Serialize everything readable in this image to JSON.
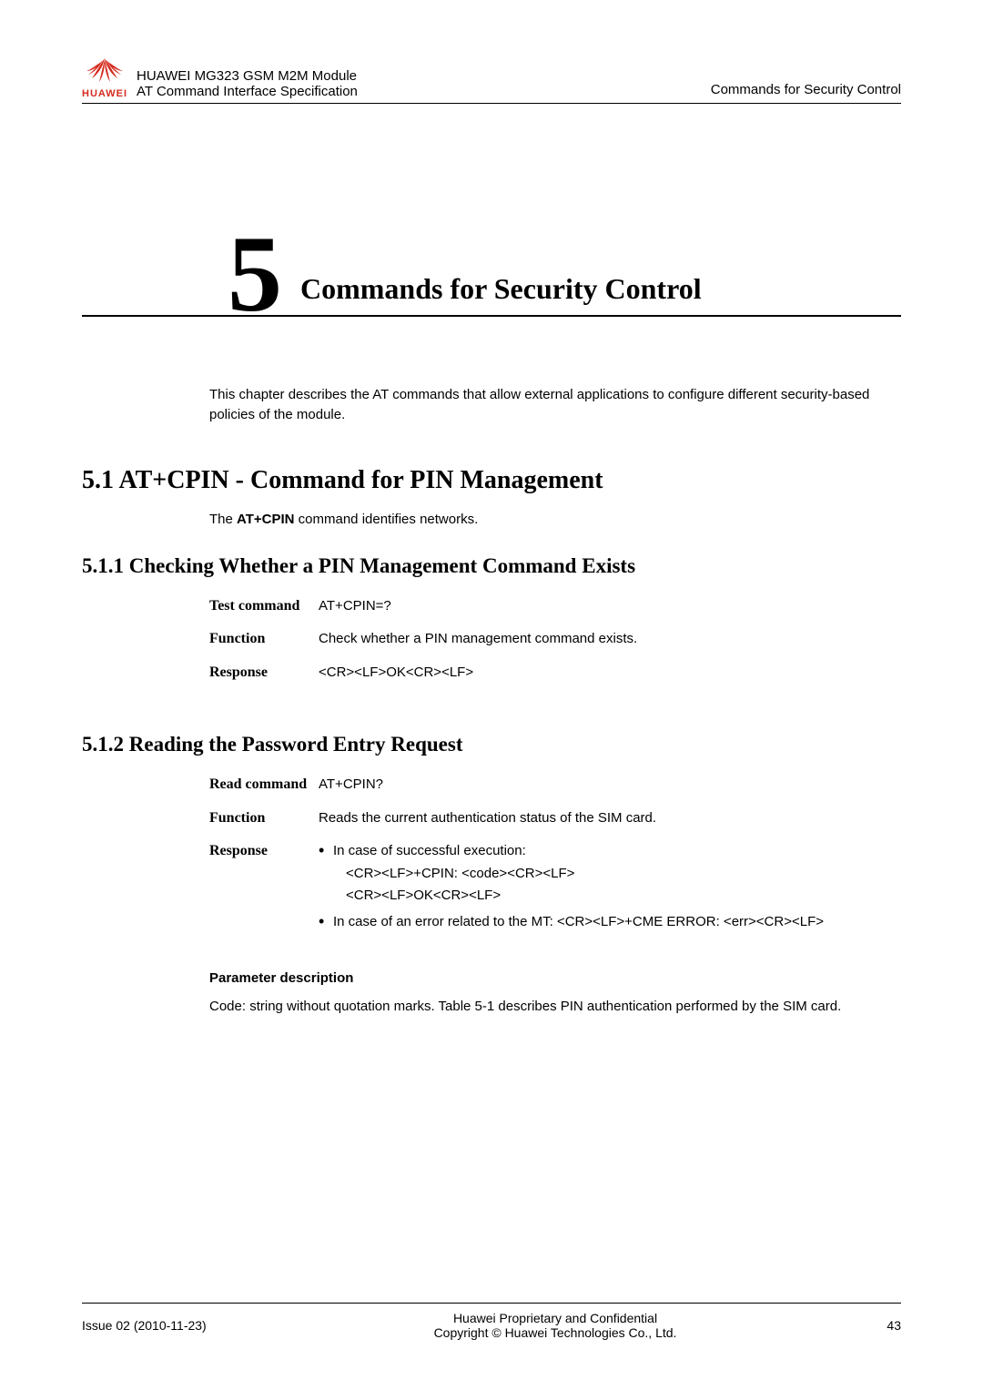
{
  "header": {
    "logo_text": "HUAWEI",
    "line1": "HUAWEI MG323 GSM M2M Module",
    "line2": "AT Command Interface Specification",
    "right": "Commands for Security Control"
  },
  "chapter": {
    "number": "5",
    "title": "Commands for Security Control"
  },
  "intro": "This chapter describes the AT commands that allow external applications to configure different security-based policies of the module.",
  "section51": {
    "heading": "5.1 AT+CPIN - Command for PIN Management",
    "desc_prefix": "The ",
    "desc_bold": "AT+CPIN",
    "desc_suffix": " command identifies networks."
  },
  "section511": {
    "heading": "5.1.1 Checking Whether a PIN Management Command Exists",
    "rows": {
      "test_label": "Test command",
      "test_value": "AT+CPIN=?",
      "func_label": "Function",
      "func_value": "Check whether a PIN management command exists.",
      "resp_label": "Response",
      "resp_value": "<CR><LF>OK<CR><LF>"
    }
  },
  "section512": {
    "heading": "5.1.2 Reading the Password Entry Request",
    "rows": {
      "read_label": "Read command",
      "read_value": "AT+CPIN?",
      "func_label": "Function",
      "func_value": "Reads the current authentication status of the SIM card.",
      "resp_label": "Response",
      "resp_success_lead": "In case of successful execution:",
      "resp_success_line1": "<CR><LF>+CPIN: <code><CR><LF>",
      "resp_success_line2": "<CR><LF>OK<CR><LF>",
      "resp_error": "In case of an error related to the MT: <CR><LF>+CME ERROR: <err><CR><LF>"
    },
    "param_heading": "Parameter description",
    "param_body": "Code: string without quotation marks. Table 5-1 describes PIN authentication performed by the SIM card."
  },
  "footer": {
    "left": "Issue 02 (2010-11-23)",
    "center1": "Huawei Proprietary and Confidential",
    "center2": "Copyright © Huawei Technologies Co., Ltd.",
    "right": "43"
  }
}
